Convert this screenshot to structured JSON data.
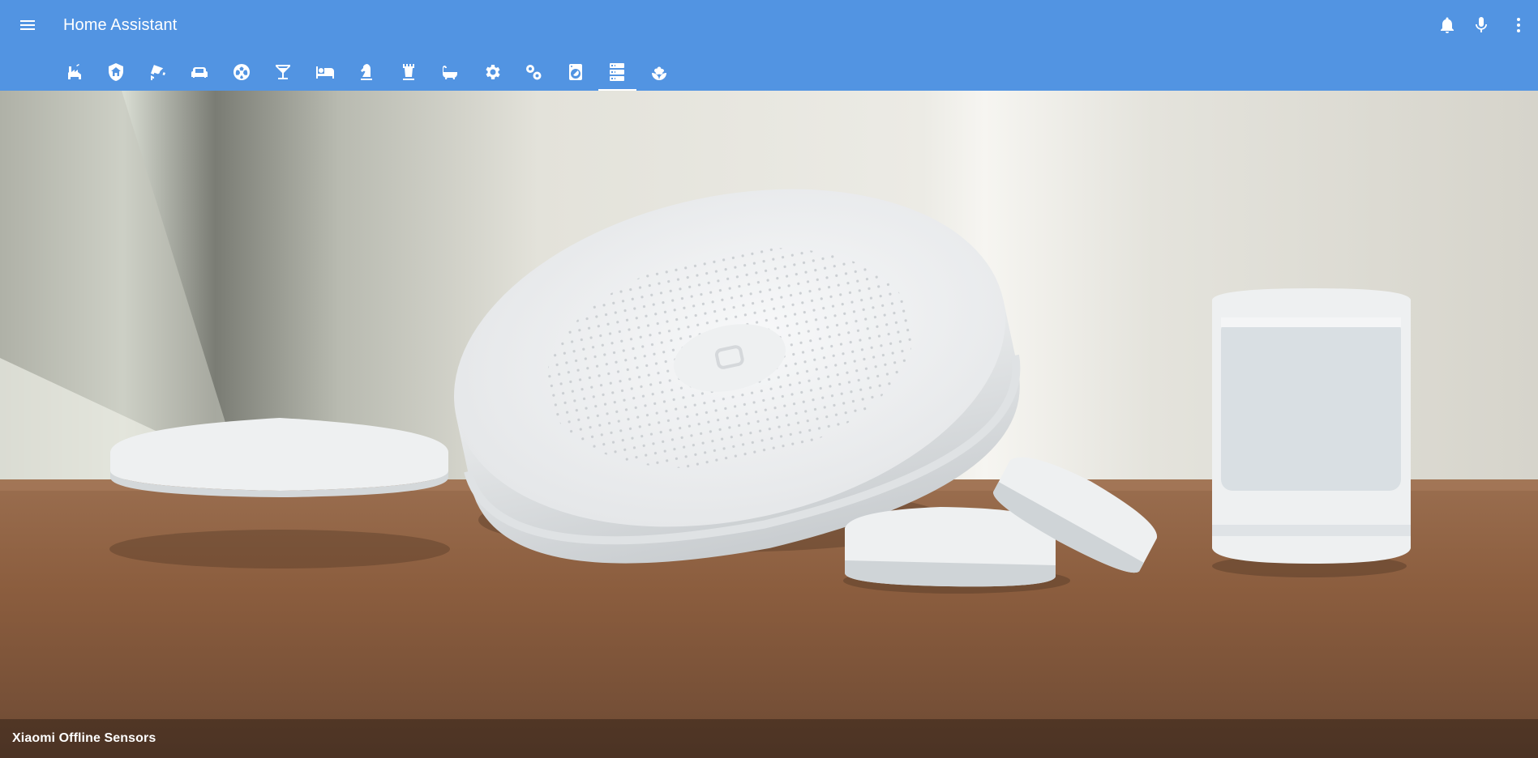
{
  "app": {
    "title": "Home Assistant",
    "colors": {
      "toolbar": "#5294e2",
      "toolbar_text": "#ffffff"
    }
  },
  "header": {
    "menu_icon": "menu-icon",
    "actions": [
      {
        "icon": "bell-icon"
      },
      {
        "icon": "microphone-icon"
      },
      {
        "icon": "dots-vertical-icon"
      }
    ]
  },
  "tabs": [
    {
      "icon": "factory-icon",
      "active": false
    },
    {
      "icon": "shield-home-icon",
      "active": false
    },
    {
      "icon": "cctv-icon",
      "active": false
    },
    {
      "icon": "sofa-icon",
      "active": false
    },
    {
      "icon": "soccer-icon",
      "active": false
    },
    {
      "icon": "glass-cocktail-icon",
      "active": false
    },
    {
      "icon": "bed-icon",
      "active": false
    },
    {
      "icon": "chess-knight-icon",
      "active": false
    },
    {
      "icon": "chess-rook-icon",
      "active": false
    },
    {
      "icon": "bathtub-icon",
      "active": false
    },
    {
      "icon": "settings-icon",
      "active": false
    },
    {
      "icon": "settings-multiple-icon",
      "active": false
    },
    {
      "icon": "washing-machine-icon",
      "active": false
    },
    {
      "icon": "server-icon",
      "active": true
    },
    {
      "icon": "flower-icon",
      "active": false
    }
  ],
  "card": {
    "title": "Xiaomi Offline Sensors",
    "image_icon": "xiaomi-sensors-photo"
  }
}
